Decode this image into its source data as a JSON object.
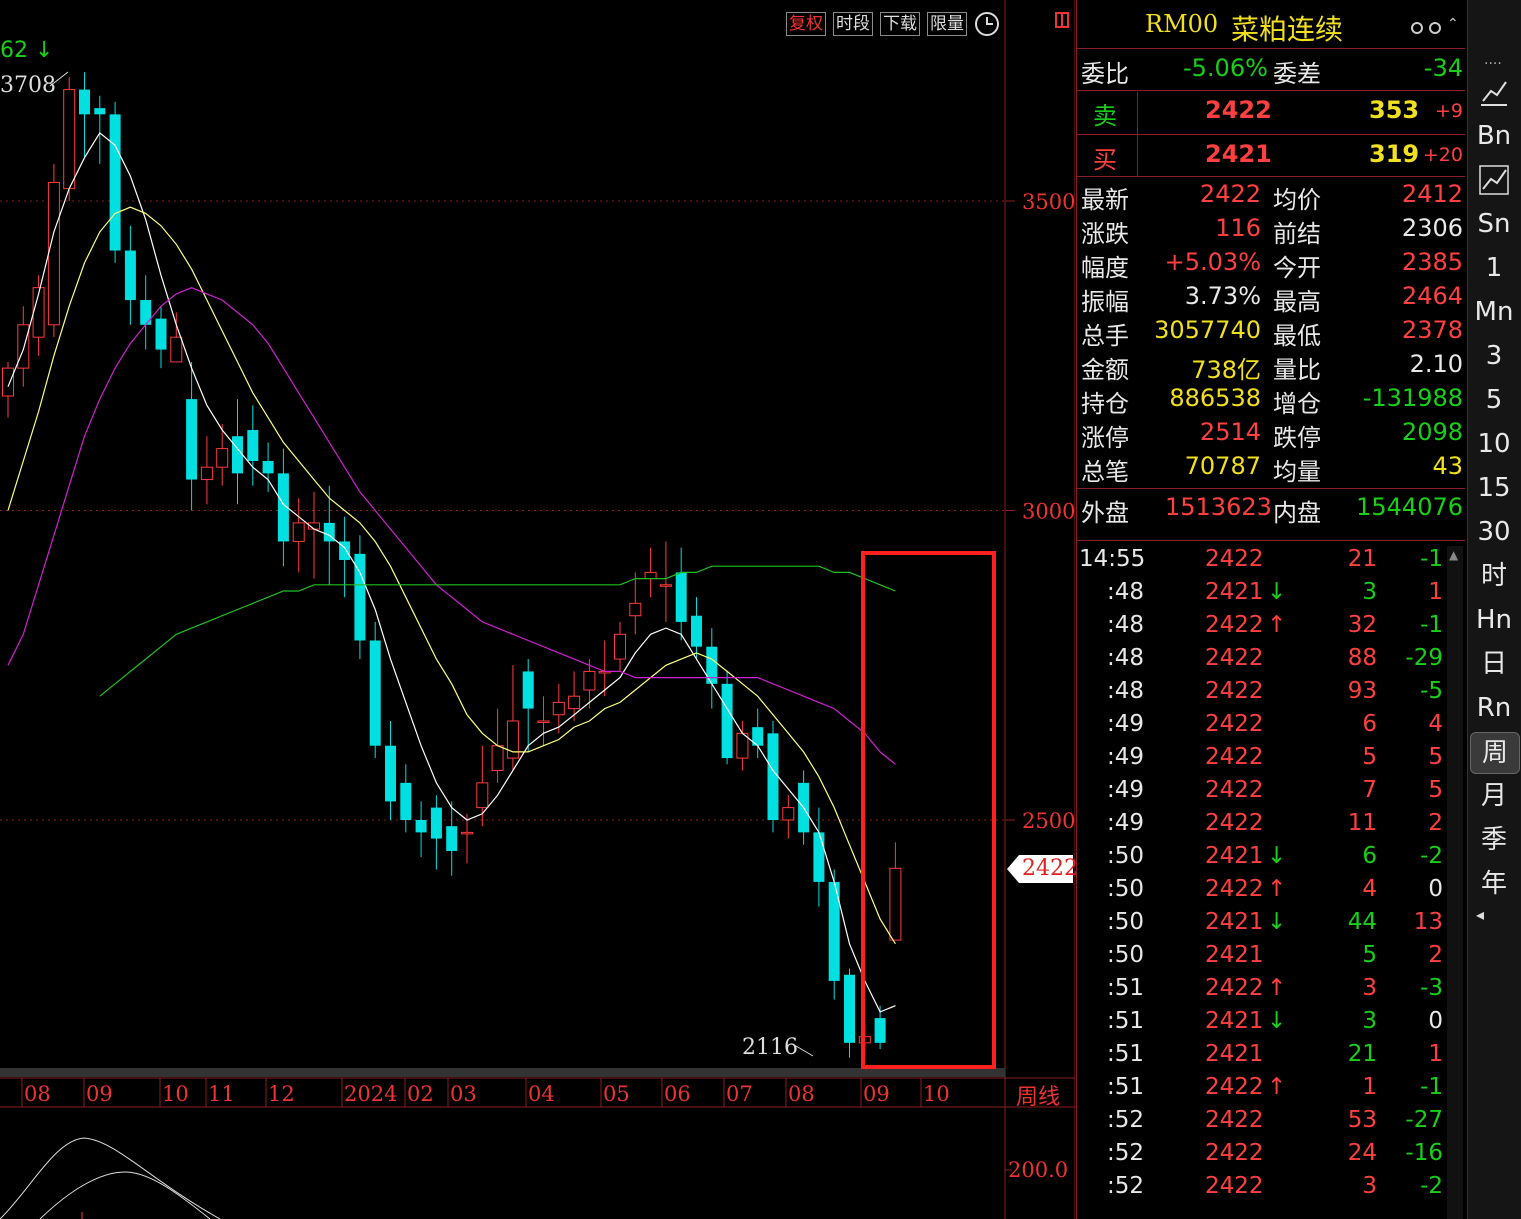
{
  "toolbar": {
    "buttons": [
      {
        "label": "复权",
        "active": true
      },
      {
        "label": "时段",
        "active": false
      },
      {
        "label": "下载",
        "active": false
      },
      {
        "label": "限量",
        "active": false
      }
    ],
    "clock_icon": "clock-icon",
    "period_icon": "bar-period-icon"
  },
  "chart": {
    "top_left_value": "62",
    "top_left_arrow": "↓",
    "high_label": "3708",
    "low_label": "2116",
    "last_price_tag": "2422",
    "period_label": "周线",
    "y_ticks": [
      "3500",
      "3000",
      "2500"
    ],
    "y_values": [
      3500,
      3000,
      2500
    ],
    "x_ticks": [
      "08",
      "09",
      "10",
      "11",
      "12",
      "2024",
      "02",
      "03",
      "04",
      "05",
      "06",
      "07",
      "08",
      "09",
      "10"
    ],
    "sub_tick": "200.0",
    "colors": {
      "up": "#ff3b3b",
      "down": "#00e0e0",
      "ma5": "#ffffff",
      "ma10": "#ffff80",
      "ma20": "#d020d0",
      "ma60": "#20c020",
      "grid": "#8b1e1e",
      "highlight": "#ff2020"
    }
  },
  "chart_data": {
    "type": "candlestick",
    "ylim": [
      2050,
      3850
    ],
    "candles": [
      [
        3185,
        3230,
        3150,
        3240
      ],
      [
        3230,
        3300,
        3200,
        3330
      ],
      [
        3280,
        3360,
        3250,
        3380
      ],
      [
        3300,
        3530,
        3280,
        3560
      ],
      [
        3520,
        3680,
        3500,
        3700
      ],
      [
        3680,
        3640,
        3570,
        3708
      ],
      [
        3650,
        3640,
        3560,
        3670
      ],
      [
        3640,
        3420,
        3400,
        3660
      ],
      [
        3420,
        3340,
        3300,
        3460
      ],
      [
        3340,
        3300,
        3260,
        3380
      ],
      [
        3310,
        3260,
        3230,
        3330
      ],
      [
        3240,
        3280,
        3240,
        3320
      ],
      [
        3180,
        3050,
        3000,
        3240
      ],
      [
        3050,
        3070,
        3010,
        3120
      ],
      [
        3070,
        3100,
        3040,
        3140
      ],
      [
        3120,
        3060,
        3010,
        3180
      ],
      [
        3130,
        3080,
        3040,
        3170
      ],
      [
        3080,
        3060,
        3030,
        3110
      ],
      [
        3060,
        2950,
        2910,
        3100
      ],
      [
        2950,
        2980,
        2900,
        3020
      ],
      [
        2970,
        2980,
        2890,
        3030
      ],
      [
        2980,
        2950,
        2880,
        3040
      ],
      [
        2950,
        2920,
        2860,
        2990
      ],
      [
        2930,
        2790,
        2760,
        2960
      ],
      [
        2790,
        2620,
        2600,
        2820
      ],
      [
        2620,
        2530,
        2500,
        2660
      ],
      [
        2560,
        2500,
        2480,
        2590
      ],
      [
        2500,
        2480,
        2440,
        2530
      ],
      [
        2520,
        2470,
        2420,
        2540
      ],
      [
        2490,
        2450,
        2410,
        2530
      ],
      [
        2480,
        2480,
        2430,
        2510
      ],
      [
        2520,
        2560,
        2490,
        2620
      ],
      [
        2580,
        2620,
        2560,
        2680
      ],
      [
        2600,
        2660,
        2580,
        2750
      ],
      [
        2740,
        2680,
        2610,
        2760
      ],
      [
        2660,
        2660,
        2620,
        2700
      ],
      [
        2670,
        2690,
        2640,
        2720
      ],
      [
        2680,
        2700,
        2660,
        2740
      ],
      [
        2710,
        2740,
        2680,
        2760
      ],
      [
        2740,
        2740,
        2700,
        2790
      ],
      [
        2760,
        2800,
        2740,
        2820
      ],
      [
        2830,
        2850,
        2800,
        2900
      ],
      [
        2890,
        2900,
        2860,
        2940
      ],
      [
        2880,
        2880,
        2820,
        2950
      ],
      [
        2900,
        2820,
        2790,
        2940
      ],
      [
        2830,
        2780,
        2760,
        2860
      ],
      [
        2780,
        2720,
        2680,
        2810
      ],
      [
        2720,
        2600,
        2590,
        2740
      ],
      [
        2600,
        2640,
        2580,
        2660
      ],
      [
        2650,
        2620,
        2600,
        2680
      ],
      [
        2640,
        2500,
        2480,
        2660
      ],
      [
        2500,
        2520,
        2470,
        2540
      ],
      [
        2560,
        2480,
        2460,
        2580
      ],
      [
        2480,
        2400,
        2360,
        2520
      ],
      [
        2400,
        2240,
        2210,
        2420
      ],
      [
        2250,
        2140,
        2116,
        2260
      ],
      [
        2140,
        2150,
        2120,
        2170
      ],
      [
        2180,
        2140,
        2130,
        2200
      ],
      [
        2306,
        2422,
        2378,
        2464
      ]
    ],
    "ma5": [
      3200,
      3260,
      3350,
      3450,
      3520,
      3570,
      3610,
      3590,
      3540,
      3470,
      3380,
      3300,
      3230,
      3170,
      3130,
      3100,
      3070,
      3050,
      3010,
      2990,
      2970,
      2960,
      2940,
      2900,
      2840,
      2760,
      2690,
      2620,
      2560,
      2520,
      2500,
      2510,
      2540,
      2580,
      2620,
      2640,
      2650,
      2670,
      2690,
      2710,
      2730,
      2770,
      2800,
      2810,
      2800,
      2760,
      2720,
      2680,
      2640,
      2620,
      2580,
      2550,
      2520,
      2480,
      2400,
      2300,
      2240,
      2190,
      2200
    ],
    "ma10": [
      3000,
      3080,
      3160,
      3250,
      3330,
      3400,
      3450,
      3480,
      3490,
      3480,
      3460,
      3430,
      3390,
      3340,
      3290,
      3240,
      3190,
      3150,
      3110,
      3080,
      3050,
      3020,
      3000,
      2980,
      2950,
      2910,
      2860,
      2810,
      2760,
      2720,
      2670,
      2640,
      2620,
      2610,
      2610,
      2620,
      2630,
      2650,
      2660,
      2680,
      2690,
      2710,
      2730,
      2750,
      2760,
      2770,
      2760,
      2740,
      2720,
      2700,
      2670,
      2640,
      2610,
      2570,
      2520,
      2460,
      2400,
      2340,
      2300
    ],
    "ma20": [
      2750,
      2800,
      2880,
      2960,
      3040,
      3120,
      3180,
      3230,
      3270,
      3300,
      3330,
      3350,
      3360,
      3350,
      3340,
      3320,
      3300,
      3270,
      3230,
      3190,
      3150,
      3110,
      3070,
      3030,
      3000,
      2970,
      2940,
      2910,
      2880,
      2860,
      2840,
      2820,
      2810,
      2800,
      2790,
      2780,
      2770,
      2760,
      2750,
      2740,
      2740,
      2730,
      2730,
      2730,
      2730,
      2730,
      2730,
      2730,
      2730,
      2730,
      2720,
      2710,
      2700,
      2690,
      2680,
      2660,
      2640,
      2610,
      2590
    ],
    "ma60": [
      null,
      null,
      null,
      null,
      null,
      null,
      2700,
      2720,
      2740,
      2760,
      2780,
      2800,
      2810,
      2820,
      2830,
      2840,
      2850,
      2860,
      2870,
      2870,
      2880,
      2880,
      2880,
      2880,
      2880,
      2880,
      2880,
      2880,
      2880,
      2880,
      2880,
      2880,
      2880,
      2880,
      2880,
      2880,
      2880,
      2880,
      2880,
      2880,
      2880,
      2890,
      2890,
      2890,
      2900,
      2900,
      2910,
      2910,
      2910,
      2910,
      2910,
      2910,
      2910,
      2910,
      2900,
      2900,
      2890,
      2880,
      2870
    ]
  },
  "quote": {
    "symbol": "RM00",
    "name": "菜粕连续",
    "icons": [
      "gear-icon",
      "settings-icon",
      "collapse-icon"
    ],
    "weibi_label": "委比",
    "weibi": "-5.06%",
    "weicha_label": "委差",
    "weicha": "-34",
    "sell_label": "卖",
    "sell_price": "2422",
    "sell_vol": "353",
    "sell_chg": "+9",
    "buy_label": "买",
    "buy_price": "2421",
    "buy_vol": "319",
    "buy_chg": "+20",
    "rows": [
      {
        "l1": "最新",
        "v1": "2422",
        "c1": "red",
        "l2": "均价",
        "v2": "2412",
        "c2": "red"
      },
      {
        "l1": "涨跌",
        "v1": "116",
        "c1": "red",
        "l2": "前结",
        "v2": "2306",
        "c2": "white"
      },
      {
        "l1": "幅度",
        "v1": "+5.03%",
        "c1": "red",
        "l2": "今开",
        "v2": "2385",
        "c2": "red"
      },
      {
        "l1": "振幅",
        "v1": "3.73%",
        "c1": "white",
        "l2": "最高",
        "v2": "2464",
        "c2": "red"
      },
      {
        "l1": "总手",
        "v1": "3057740",
        "c1": "yellow",
        "l2": "最低",
        "v2": "2378",
        "c2": "red"
      },
      {
        "l1": "金额",
        "v1": "738亿",
        "c1": "yellow",
        "l2": "量比",
        "v2": "2.10",
        "c2": "white"
      },
      {
        "l1": "持仓",
        "v1": "886538",
        "c1": "yellow",
        "l2": "增仓",
        "v2": "-131988",
        "c2": "green"
      },
      {
        "l1": "涨停",
        "v1": "2514",
        "c1": "red",
        "l2": "跌停",
        "v2": "2098",
        "c2": "green"
      },
      {
        "l1": "总笔",
        "v1": "70787",
        "c1": "yellow",
        "l2": "均量",
        "v2": "43",
        "c2": "yellow"
      }
    ],
    "waipan_label": "外盘",
    "waipan": "1513623",
    "neipan_label": "内盘",
    "neipan": "1544076",
    "ticks": [
      {
        "t": "14:55",
        "p": "2422",
        "d": "",
        "v": "21",
        "vc": "red",
        "c": "-1",
        "cc": "green"
      },
      {
        "t": ":48",
        "p": "2421",
        "d": "↓",
        "v": "3",
        "vc": "green",
        "c": "1",
        "cc": "red"
      },
      {
        "t": ":48",
        "p": "2422",
        "d": "↑",
        "v": "32",
        "vc": "red",
        "c": "-1",
        "cc": "green"
      },
      {
        "t": ":48",
        "p": "2422",
        "d": "",
        "v": "88",
        "vc": "red",
        "c": "-29",
        "cc": "green"
      },
      {
        "t": ":48",
        "p": "2422",
        "d": "",
        "v": "93",
        "vc": "red",
        "c": "-5",
        "cc": "green"
      },
      {
        "t": ":49",
        "p": "2422",
        "d": "",
        "v": "6",
        "vc": "red",
        "c": "4",
        "cc": "red"
      },
      {
        "t": ":49",
        "p": "2422",
        "d": "",
        "v": "5",
        "vc": "red",
        "c": "5",
        "cc": "red"
      },
      {
        "t": ":49",
        "p": "2422",
        "d": "",
        "v": "7",
        "vc": "red",
        "c": "5",
        "cc": "red"
      },
      {
        "t": ":49",
        "p": "2422",
        "d": "",
        "v": "11",
        "vc": "red",
        "c": "2",
        "cc": "red"
      },
      {
        "t": ":50",
        "p": "2421",
        "d": "↓",
        "v": "6",
        "vc": "green",
        "c": "-2",
        "cc": "green"
      },
      {
        "t": ":50",
        "p": "2422",
        "d": "↑",
        "v": "4",
        "vc": "red",
        "c": "0",
        "cc": "white"
      },
      {
        "t": ":50",
        "p": "2421",
        "d": "↓",
        "v": "44",
        "vc": "green",
        "c": "13",
        "cc": "red"
      },
      {
        "t": ":50",
        "p": "2421",
        "d": "",
        "v": "5",
        "vc": "green",
        "c": "2",
        "cc": "red"
      },
      {
        "t": ":51",
        "p": "2422",
        "d": "↑",
        "v": "3",
        "vc": "red",
        "c": "-3",
        "cc": "green"
      },
      {
        "t": ":51",
        "p": "2421",
        "d": "↓",
        "v": "3",
        "vc": "green",
        "c": "0",
        "cc": "white"
      },
      {
        "t": ":51",
        "p": "2421",
        "d": "",
        "v": "21",
        "vc": "green",
        "c": "1",
        "cc": "red"
      },
      {
        "t": ":51",
        "p": "2422",
        "d": "↑",
        "v": "1",
        "vc": "red",
        "c": "-1",
        "cc": "green"
      },
      {
        "t": ":52",
        "p": "2422",
        "d": "",
        "v": "53",
        "vc": "red",
        "c": "-27",
        "cc": "green"
      },
      {
        "t": ":52",
        "p": "2422",
        "d": "",
        "v": "24",
        "vc": "red",
        "c": "-16",
        "cc": "green"
      },
      {
        "t": ":52",
        "p": "2422",
        "d": "",
        "v": "3",
        "vc": "red",
        "c": "-2",
        "cc": "green"
      }
    ]
  },
  "sidebar": {
    "top_dots": "....",
    "items": [
      {
        "label": "",
        "icon": "line-chart-icon"
      },
      {
        "label": "Bn"
      },
      {
        "label": "",
        "icon": "trend-chart-icon"
      },
      {
        "label": "Sn"
      },
      {
        "label": "1"
      },
      {
        "label": "Mn"
      },
      {
        "label": "3"
      },
      {
        "label": "5"
      },
      {
        "label": "10"
      },
      {
        "label": "15"
      },
      {
        "label": "30"
      },
      {
        "label": "时"
      },
      {
        "label": "Hn"
      },
      {
        "label": "日"
      },
      {
        "label": "Rn"
      },
      {
        "label": "周",
        "active": true
      },
      {
        "label": "月"
      },
      {
        "label": "季"
      },
      {
        "label": "年"
      }
    ],
    "bottom_arrow": "◂"
  }
}
